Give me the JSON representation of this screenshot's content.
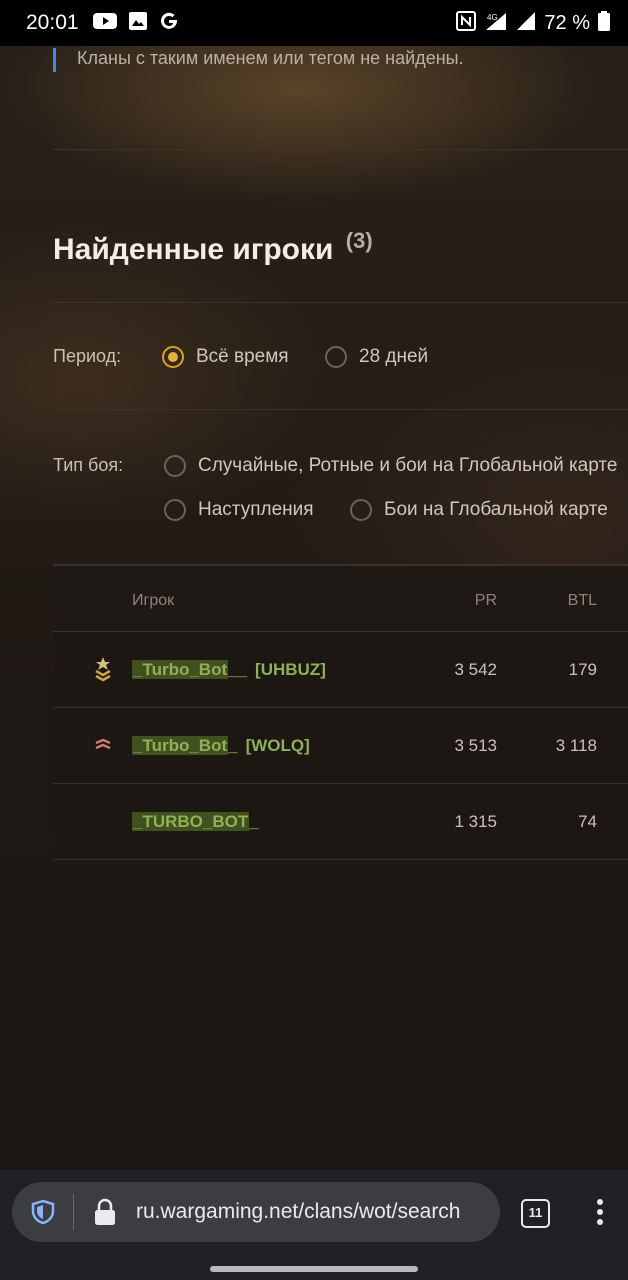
{
  "status_bar": {
    "time": "20:01",
    "left_icons": [
      "youtube-icon",
      "image-icon",
      "google-icon"
    ],
    "network": "4G",
    "battery": "72 %"
  },
  "page": {
    "notice": "Кланы с таким именем или тегом не найдены.",
    "section_title": "Найденные игроки",
    "section_count": "(3)",
    "period": {
      "label": "Период:",
      "options": [
        {
          "label": "Всё время",
          "checked": true
        },
        {
          "label": "28 дней",
          "checked": false
        }
      ]
    },
    "battle_type": {
      "label": "Тип боя:",
      "options": [
        {
          "label": "Случайные, Ротные и бои на Глобальной карте",
          "checked": false
        },
        {
          "label": "Наступления",
          "checked": false
        },
        {
          "label": "Бои на Глобальной карте",
          "checked": false
        }
      ]
    },
    "table": {
      "columns": {
        "player": "Игрок",
        "pr": "PR",
        "btl": "BTL"
      },
      "rows": [
        {
          "name": "_Turbo_Bot",
          "name_tail": "__",
          "tag": "[UHBUZ]",
          "pr": "3 542",
          "btl": "179",
          "rank_icon": "rank-star-chevron-icon"
        },
        {
          "name": "_Turbo_Bot",
          "name_tail": "_",
          "tag": "[WOLQ]",
          "pr": "3 513",
          "btl": "3 118",
          "rank_icon": "rank-stripes-icon"
        },
        {
          "name": "_TURBO_BOT",
          "name_tail": "_",
          "tag": "",
          "pr": "1 315",
          "btl": "74",
          "rank_icon": ""
        }
      ]
    }
  },
  "browser": {
    "url": "ru.wargaming.net/clans/wot/search",
    "tab_count": "11"
  },
  "colors": {
    "accent_radio": "#e6b13a",
    "player_name": "#8fb05a",
    "notice_bar": "#3a8ce0"
  }
}
